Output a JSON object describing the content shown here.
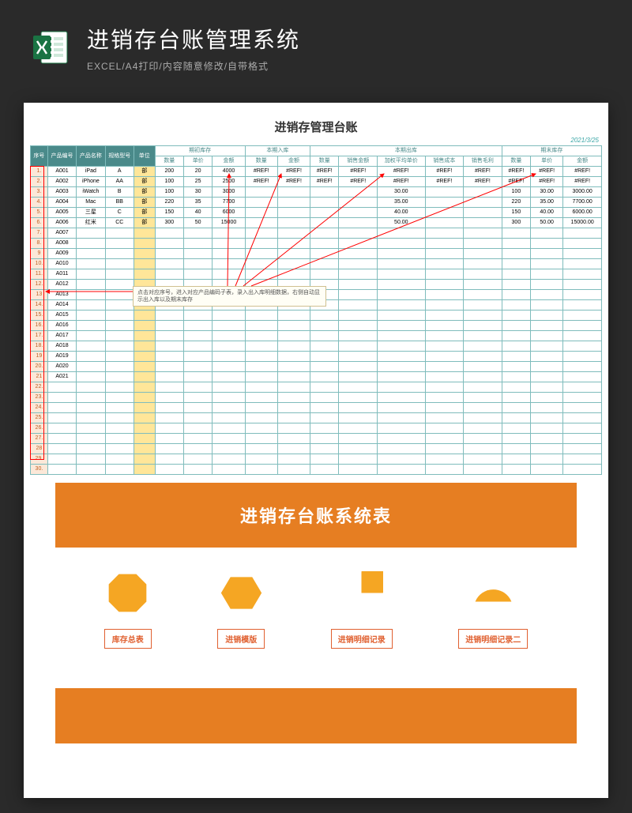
{
  "header": {
    "title": "进销存台账管理系统",
    "subtitle": "EXCEL/A4打印/内容随意修改/自带格式"
  },
  "sheet": {
    "title": "进销存管理台账",
    "date": "2021/3/25",
    "col_groups": [
      "期初库存",
      "本期入库",
      "本期出库",
      "期末库存"
    ],
    "heads_left": [
      "序号",
      "产品编号",
      "产品名称",
      "规格型号",
      "单位"
    ],
    "heads_init": [
      "数量",
      "单价",
      "金额"
    ],
    "heads_in": [
      "数量",
      "金额"
    ],
    "heads_out": [
      "数量",
      "销售金额",
      "加权平均单价",
      "销售成本",
      "销售毛利"
    ],
    "heads_end": [
      "数量",
      "单价",
      "金额"
    ],
    "rows": [
      {
        "n": "1.",
        "id": "A001",
        "name": "iPad",
        "spec": "A",
        "unit": "部",
        "qi": [
          "200",
          "20",
          "4000"
        ],
        "in": [
          "#REF!",
          "#REF!"
        ],
        "out": [
          "#REF!",
          "#REF!",
          "#REF!",
          "#REF!",
          "#REF!"
        ],
        "end": [
          "#REF!",
          "#REF!",
          "#REF!"
        ]
      },
      {
        "n": "2.",
        "id": "A002",
        "name": "iPhone",
        "spec": "AA",
        "unit": "部",
        "qi": [
          "100",
          "25",
          "2500"
        ],
        "in": [
          "#REF!",
          "#REF!"
        ],
        "out": [
          "#REF!",
          "#REF!",
          "#REF!",
          "#REF!",
          "#REF!"
        ],
        "end": [
          "#REF!",
          "#REF!",
          "#REF!"
        ]
      },
      {
        "n": "3.",
        "id": "A003",
        "name": "iWatch",
        "spec": "B",
        "unit": "部",
        "qi": [
          "100",
          "30",
          "3000"
        ],
        "in": [
          "",
          ""
        ],
        "out": [
          "",
          "",
          "30.00",
          "",
          ""
        ],
        "end": [
          "100",
          "30.00",
          "3000.00"
        ]
      },
      {
        "n": "4.",
        "id": "A004",
        "name": "Mac",
        "spec": "BB",
        "unit": "部",
        "qi": [
          "220",
          "35",
          "7700"
        ],
        "in": [
          "",
          ""
        ],
        "out": [
          "",
          "",
          "35.00",
          "",
          ""
        ],
        "end": [
          "220",
          "35.00",
          "7700.00"
        ]
      },
      {
        "n": "5.",
        "id": "A005",
        "name": "三星",
        "spec": "C",
        "unit": "部",
        "qi": [
          "150",
          "40",
          "6000"
        ],
        "in": [
          "",
          ""
        ],
        "out": [
          "",
          "",
          "40.00",
          "",
          ""
        ],
        "end": [
          "150",
          "40.00",
          "6000.00"
        ]
      },
      {
        "n": "6.",
        "id": "A006",
        "name": "红米",
        "spec": "CC",
        "unit": "部",
        "qi": [
          "300",
          "50",
          "15000"
        ],
        "in": [
          "",
          ""
        ],
        "out": [
          "",
          "",
          "50.00",
          "",
          ""
        ],
        "end": [
          "300",
          "50.00",
          "15000.00"
        ]
      },
      {
        "n": "7.",
        "id": "A007",
        "name": "",
        "spec": "",
        "unit": "",
        "qi": [
          "",
          "",
          ""
        ],
        "in": [
          "",
          ""
        ],
        "out": [
          "",
          "",
          "",
          "",
          ""
        ],
        "end": [
          "",
          "",
          ""
        ]
      },
      {
        "n": "8.",
        "id": "A008",
        "name": "",
        "spec": "",
        "unit": "",
        "qi": [
          "",
          "",
          ""
        ],
        "in": [
          "",
          ""
        ],
        "out": [
          "",
          "",
          "",
          "",
          ""
        ],
        "end": [
          "",
          "",
          ""
        ]
      },
      {
        "n": "9",
        "id": "A009",
        "name": "",
        "spec": "",
        "unit": "",
        "qi": [
          "",
          "",
          ""
        ],
        "in": [
          "",
          ""
        ],
        "out": [
          "",
          "",
          "",
          "",
          ""
        ],
        "end": [
          "",
          "",
          ""
        ]
      },
      {
        "n": "10.",
        "id": "A010",
        "name": "",
        "spec": "",
        "unit": "",
        "qi": [
          "",
          "",
          ""
        ],
        "in": [
          "",
          ""
        ],
        "out": [
          "",
          "",
          "",
          "",
          ""
        ],
        "end": [
          "",
          "",
          ""
        ]
      },
      {
        "n": "11.",
        "id": "A011",
        "name": "",
        "spec": "",
        "unit": "",
        "qi": [
          "",
          "",
          ""
        ],
        "in": [
          "",
          ""
        ],
        "out": [
          "",
          "",
          "",
          "",
          ""
        ],
        "end": [
          "",
          "",
          ""
        ]
      },
      {
        "n": "12.",
        "id": "A012",
        "name": "",
        "spec": "",
        "unit": "",
        "qi": [
          "",
          "",
          ""
        ],
        "in": [
          "",
          ""
        ],
        "out": [
          "",
          "",
          "",
          "",
          ""
        ],
        "end": [
          "",
          "",
          ""
        ]
      },
      {
        "n": "13",
        "id": "A013",
        "name": "",
        "spec": "",
        "unit": "",
        "qi": [
          "",
          "",
          ""
        ],
        "in": [
          "",
          ""
        ],
        "out": [
          "",
          "",
          "",
          "",
          ""
        ],
        "end": [
          "",
          "",
          ""
        ]
      },
      {
        "n": "14.",
        "id": "A014",
        "name": "",
        "spec": "",
        "unit": "",
        "qi": [
          "",
          "",
          ""
        ],
        "in": [
          "",
          ""
        ],
        "out": [
          "",
          "",
          "",
          "",
          ""
        ],
        "end": [
          "",
          "",
          ""
        ]
      },
      {
        "n": "15.",
        "id": "A015",
        "name": "",
        "spec": "",
        "unit": "",
        "qi": [
          "",
          "",
          ""
        ],
        "in": [
          "",
          ""
        ],
        "out": [
          "",
          "",
          "",
          "",
          ""
        ],
        "end": [
          "",
          "",
          ""
        ]
      },
      {
        "n": "16.",
        "id": "A016",
        "name": "",
        "spec": "",
        "unit": "",
        "qi": [
          "",
          "",
          ""
        ],
        "in": [
          "",
          ""
        ],
        "out": [
          "",
          "",
          "",
          "",
          ""
        ],
        "end": [
          "",
          "",
          ""
        ]
      },
      {
        "n": "17.",
        "id": "A017",
        "name": "",
        "spec": "",
        "unit": "",
        "qi": [
          "",
          "",
          ""
        ],
        "in": [
          "",
          ""
        ],
        "out": [
          "",
          "",
          "",
          "",
          ""
        ],
        "end": [
          "",
          "",
          ""
        ]
      },
      {
        "n": "18.",
        "id": "A018",
        "name": "",
        "spec": "",
        "unit": "",
        "qi": [
          "",
          "",
          ""
        ],
        "in": [
          "",
          ""
        ],
        "out": [
          "",
          "",
          "",
          "",
          ""
        ],
        "end": [
          "",
          "",
          ""
        ]
      },
      {
        "n": "19",
        "id": "A019",
        "name": "",
        "spec": "",
        "unit": "",
        "qi": [
          "",
          "",
          ""
        ],
        "in": [
          "",
          ""
        ],
        "out": [
          "",
          "",
          "",
          "",
          ""
        ],
        "end": [
          "",
          "",
          ""
        ]
      },
      {
        "n": "20.",
        "id": "A020",
        "name": "",
        "spec": "",
        "unit": "",
        "qi": [
          "",
          "",
          ""
        ],
        "in": [
          "",
          ""
        ],
        "out": [
          "",
          "",
          "",
          "",
          ""
        ],
        "end": [
          "",
          "",
          ""
        ]
      },
      {
        "n": "21",
        "id": "A021",
        "name": "",
        "spec": "",
        "unit": "",
        "qi": [
          "",
          "",
          ""
        ],
        "in": [
          "",
          ""
        ],
        "out": [
          "",
          "",
          "",
          "",
          ""
        ],
        "end": [
          "",
          "",
          ""
        ]
      },
      {
        "n": "22.",
        "id": "",
        "name": "",
        "spec": "",
        "unit": "",
        "qi": [
          "",
          "",
          ""
        ],
        "in": [
          "",
          ""
        ],
        "out": [
          "",
          "",
          "",
          "",
          ""
        ],
        "end": [
          "",
          "",
          ""
        ]
      },
      {
        "n": "23.",
        "id": "",
        "name": "",
        "spec": "",
        "unit": "",
        "qi": [
          "",
          "",
          ""
        ],
        "in": [
          "",
          ""
        ],
        "out": [
          "",
          "",
          "",
          "",
          ""
        ],
        "end": [
          "",
          "",
          ""
        ]
      },
      {
        "n": "24.",
        "id": "",
        "name": "",
        "spec": "",
        "unit": "",
        "qi": [
          "",
          "",
          ""
        ],
        "in": [
          "",
          ""
        ],
        "out": [
          "",
          "",
          "",
          "",
          ""
        ],
        "end": [
          "",
          "",
          ""
        ]
      },
      {
        "n": "25.",
        "id": "",
        "name": "",
        "spec": "",
        "unit": "",
        "qi": [
          "",
          "",
          ""
        ],
        "in": [
          "",
          ""
        ],
        "out": [
          "",
          "",
          "",
          "",
          ""
        ],
        "end": [
          "",
          "",
          ""
        ]
      },
      {
        "n": "26.",
        "id": "",
        "name": "",
        "spec": "",
        "unit": "",
        "qi": [
          "",
          "",
          ""
        ],
        "in": [
          "",
          ""
        ],
        "out": [
          "",
          "",
          "",
          "",
          ""
        ],
        "end": [
          "",
          "",
          ""
        ]
      },
      {
        "n": "27.",
        "id": "",
        "name": "",
        "spec": "",
        "unit": "",
        "qi": [
          "",
          "",
          ""
        ],
        "in": [
          "",
          ""
        ],
        "out": [
          "",
          "",
          "",
          "",
          ""
        ],
        "end": [
          "",
          "",
          ""
        ]
      },
      {
        "n": "28",
        "id": "",
        "name": "",
        "spec": "",
        "unit": "",
        "qi": [
          "",
          "",
          ""
        ],
        "in": [
          "",
          ""
        ],
        "out": [
          "",
          "",
          "",
          "",
          ""
        ],
        "end": [
          "",
          "",
          ""
        ]
      },
      {
        "n": "29.",
        "id": "",
        "name": "",
        "spec": "",
        "unit": "",
        "qi": [
          "",
          "",
          ""
        ],
        "in": [
          "",
          ""
        ],
        "out": [
          "",
          "",
          "",
          "",
          ""
        ],
        "end": [
          "",
          "",
          ""
        ]
      },
      {
        "n": "30.",
        "id": "",
        "name": "",
        "spec": "",
        "unit": "",
        "qi": [
          "",
          "",
          ""
        ],
        "in": [
          "",
          ""
        ],
        "out": [
          "",
          "",
          "",
          "",
          ""
        ],
        "end": [
          "",
          "",
          ""
        ]
      }
    ],
    "tooltip": "点击对应序号，进入对应产品编码子表，录入出入库明细数据，右侧自动显示出入库以及期末库存"
  },
  "banner": {
    "title": "进销存台账系统表"
  },
  "nav": {
    "items": [
      {
        "label": "库存总表",
        "shape": "octagon"
      },
      {
        "label": "进销模版",
        "shape": "hexagon"
      },
      {
        "label": "进销明细记录",
        "shape": "pac"
      },
      {
        "label": "进销明细记录二",
        "shape": "halfcircle"
      }
    ]
  }
}
